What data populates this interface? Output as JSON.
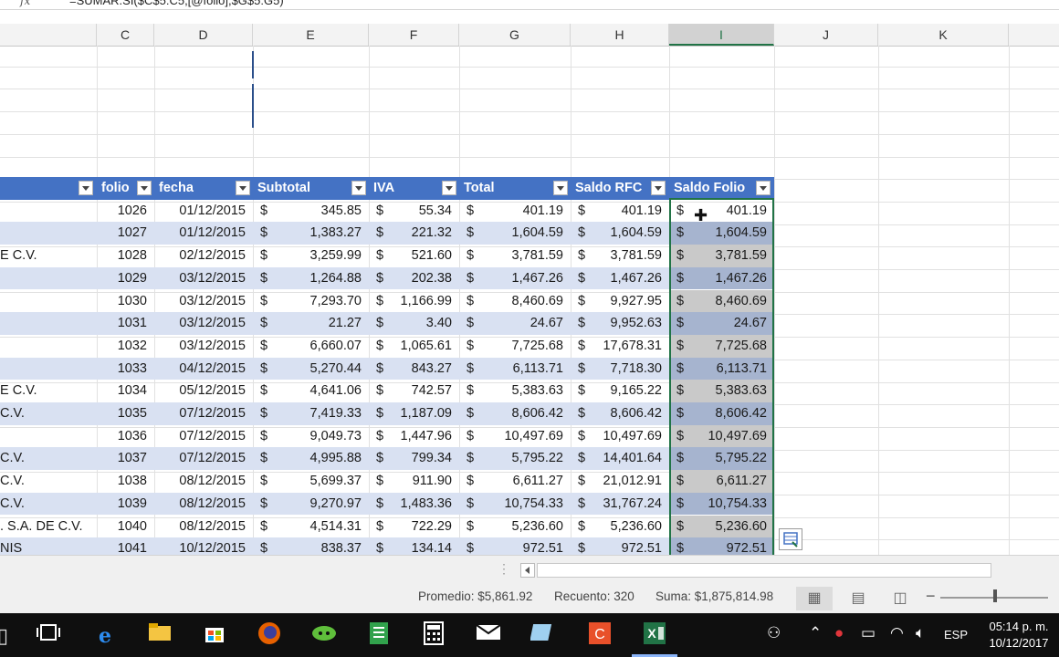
{
  "formula_bar": {
    "fx": "fx",
    "formula": "=SUMAR.SI($C$5:C5,[@folio],$G$5:G5)"
  },
  "columns": [
    {
      "id": "c",
      "label": "C"
    },
    {
      "id": "d",
      "label": "D"
    },
    {
      "id": "e",
      "label": "E"
    },
    {
      "id": "f",
      "label": "F"
    },
    {
      "id": "g",
      "label": "G"
    },
    {
      "id": "h",
      "label": "H"
    },
    {
      "id": "i",
      "label": "I"
    },
    {
      "id": "j",
      "label": "J"
    },
    {
      "id": "k",
      "label": "K"
    }
  ],
  "selected_column": "I",
  "table": {
    "headers": [
      "folio",
      "fecha",
      "Subtotal",
      "IVA",
      "Total",
      "Saldo RFC",
      "Saldo Folio"
    ],
    "currency_symbol": "$",
    "rows": [
      {
        "name": "",
        "folio": "1026",
        "fecha": "01/12/2015",
        "subtotal": "345.85",
        "iva": "55.34",
        "total": "401.19",
        "saldo_rfc": "401.19",
        "saldo_folio": "401.19"
      },
      {
        "name": "",
        "folio": "1027",
        "fecha": "01/12/2015",
        "subtotal": "1,383.27",
        "iva": "221.32",
        "total": "1,604.59",
        "saldo_rfc": "1,604.59",
        "saldo_folio": "1,604.59"
      },
      {
        "name": "E C.V.",
        "folio": "1028",
        "fecha": "02/12/2015",
        "subtotal": "3,259.99",
        "iva": "521.60",
        "total": "3,781.59",
        "saldo_rfc": "3,781.59",
        "saldo_folio": "3,781.59"
      },
      {
        "name": "",
        "folio": "1029",
        "fecha": "03/12/2015",
        "subtotal": "1,264.88",
        "iva": "202.38",
        "total": "1,467.26",
        "saldo_rfc": "1,467.26",
        "saldo_folio": "1,467.26"
      },
      {
        "name": "",
        "folio": "1030",
        "fecha": "03/12/2015",
        "subtotal": "7,293.70",
        "iva": "1,166.99",
        "total": "8,460.69",
        "saldo_rfc": "9,927.95",
        "saldo_folio": "8,460.69"
      },
      {
        "name": "",
        "folio": "1031",
        "fecha": "03/12/2015",
        "subtotal": "21.27",
        "iva": "3.40",
        "total": "24.67",
        "saldo_rfc": "9,952.63",
        "saldo_folio": "24.67"
      },
      {
        "name": "",
        "folio": "1032",
        "fecha": "03/12/2015",
        "subtotal": "6,660.07",
        "iva": "1,065.61",
        "total": "7,725.68",
        "saldo_rfc": "17,678.31",
        "saldo_folio": "7,725.68"
      },
      {
        "name": "",
        "folio": "1033",
        "fecha": "04/12/2015",
        "subtotal": "5,270.44",
        "iva": "843.27",
        "total": "6,113.71",
        "saldo_rfc": "7,718.30",
        "saldo_folio": "6,113.71"
      },
      {
        "name": "E C.V.",
        "folio": "1034",
        "fecha": "05/12/2015",
        "subtotal": "4,641.06",
        "iva": "742.57",
        "total": "5,383.63",
        "saldo_rfc": "9,165.22",
        "saldo_folio": "5,383.63"
      },
      {
        "name": "C.V.",
        "folio": "1035",
        "fecha": "07/12/2015",
        "subtotal": "7,419.33",
        "iva": "1,187.09",
        "total": "8,606.42",
        "saldo_rfc": "8,606.42",
        "saldo_folio": "8,606.42"
      },
      {
        "name": "",
        "folio": "1036",
        "fecha": "07/12/2015",
        "subtotal": "9,049.73",
        "iva": "1,447.96",
        "total": "10,497.69",
        "saldo_rfc": "10,497.69",
        "saldo_folio": "10,497.69"
      },
      {
        "name": "C.V.",
        "folio": "1037",
        "fecha": "07/12/2015",
        "subtotal": "4,995.88",
        "iva": "799.34",
        "total": "5,795.22",
        "saldo_rfc": "14,401.64",
        "saldo_folio": "5,795.22"
      },
      {
        "name": "C.V.",
        "folio": "1038",
        "fecha": "08/12/2015",
        "subtotal": "5,699.37",
        "iva": "911.90",
        "total": "6,611.27",
        "saldo_rfc": "21,012.91",
        "saldo_folio": "6,611.27"
      },
      {
        "name": "C.V.",
        "folio": "1039",
        "fecha": "08/12/2015",
        "subtotal": "9,270.97",
        "iva": "1,483.36",
        "total": "10,754.33",
        "saldo_rfc": "31,767.24",
        "saldo_folio": "10,754.33"
      },
      {
        "name": ". S.A. DE C.V.",
        "folio": "1040",
        "fecha": "08/12/2015",
        "subtotal": "4,514.31",
        "iva": "722.29",
        "total": "5,236.60",
        "saldo_rfc": "5,236.60",
        "saldo_folio": "5,236.60"
      },
      {
        "name": "NIS",
        "folio": "1041",
        "fecha": "10/12/2015",
        "subtotal": "838.37",
        "iva": "134.14",
        "total": "972.51",
        "saldo_rfc": "972.51",
        "saldo_folio": "972.51"
      }
    ]
  },
  "status_bar": {
    "promedio": "Promedio:  $5,861.92",
    "recuento": "Recuento: 320",
    "suma": "Suma:  $1,875,814.98"
  },
  "taskbar": {
    "language": "ESP",
    "time": "05:14 p. m.",
    "date": "10/12/2017"
  },
  "colors": {
    "table_header": "#4472c4",
    "band": "#d9e1f2",
    "excel_green": "#217346"
  }
}
